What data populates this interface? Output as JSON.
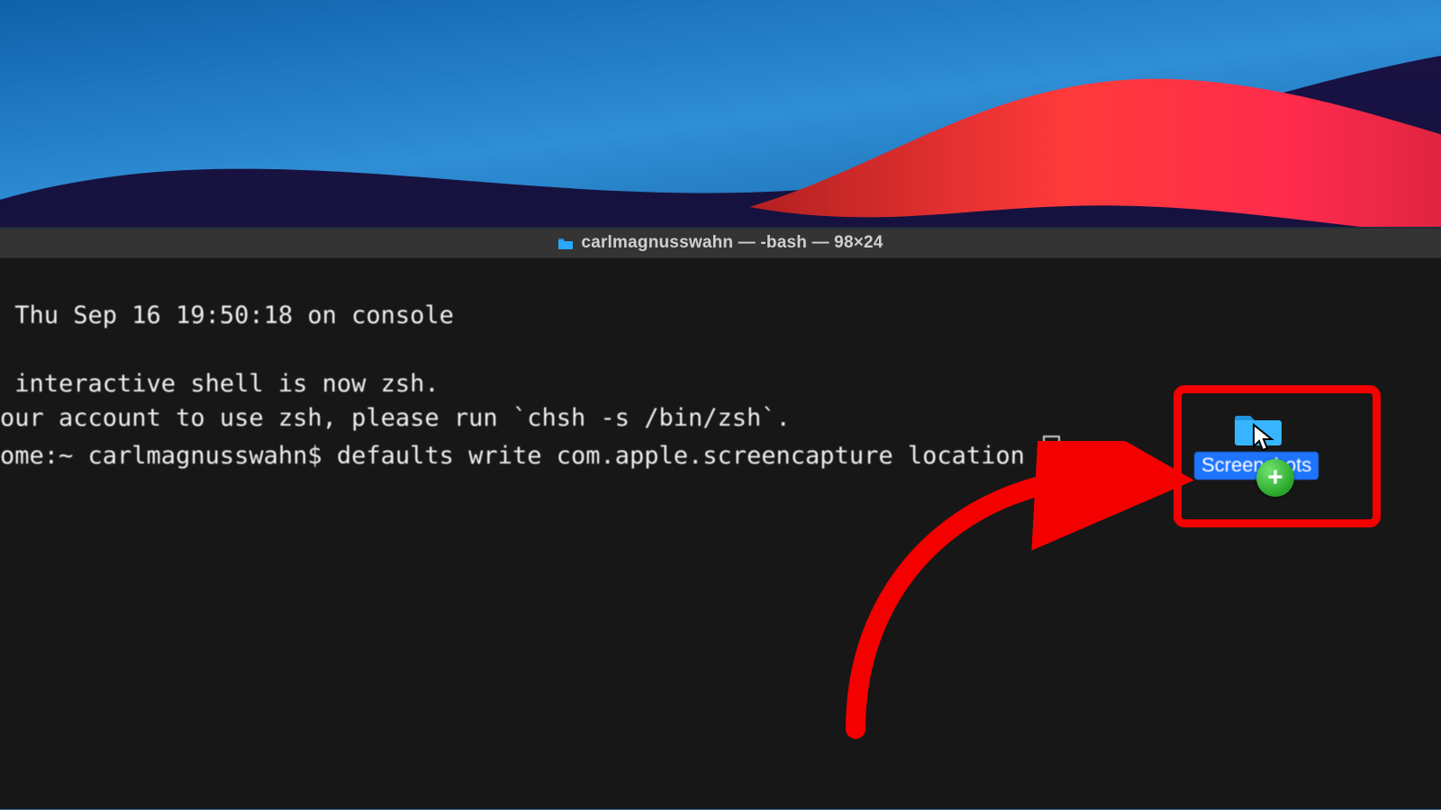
{
  "window": {
    "title": "carlmagnusswahn — -bash — 98×24"
  },
  "terminal": {
    "line1": " Thu Sep 16 19:50:18 on console",
    "line2": "",
    "line3": " interactive shell is now zsh.",
    "line4": "our account to use zsh, please run `chsh -s /bin/zsh`.",
    "prompt_user": "ome:~ carlmagnusswahn$ ",
    "command": "defaults write com.apple.screencapture location "
  },
  "drag": {
    "folder_label": "Screenshots",
    "plus": "+"
  },
  "annotation": {
    "highlight_color": "#f40000"
  }
}
